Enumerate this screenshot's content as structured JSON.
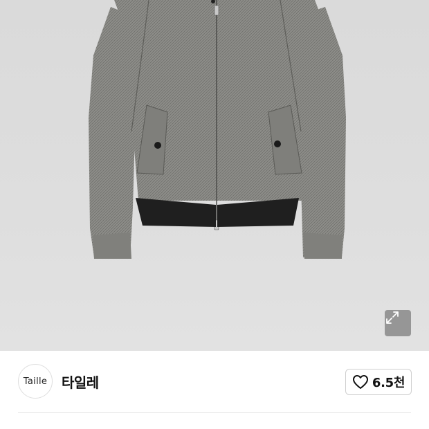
{
  "product_image": {
    "subject": "jacket-image",
    "expand_icon": "expand-arrows-icon"
  },
  "store": {
    "logo_text": "Taille",
    "name": "타일레"
  },
  "like": {
    "icon": "heart-outline-icon",
    "count": "6.5천"
  },
  "colors": {
    "image_background": "#dcdcdc",
    "jacket": "#8a8a86",
    "rib": "#1f1f1f",
    "text": "#111111",
    "border": "#cfcfcf"
  }
}
